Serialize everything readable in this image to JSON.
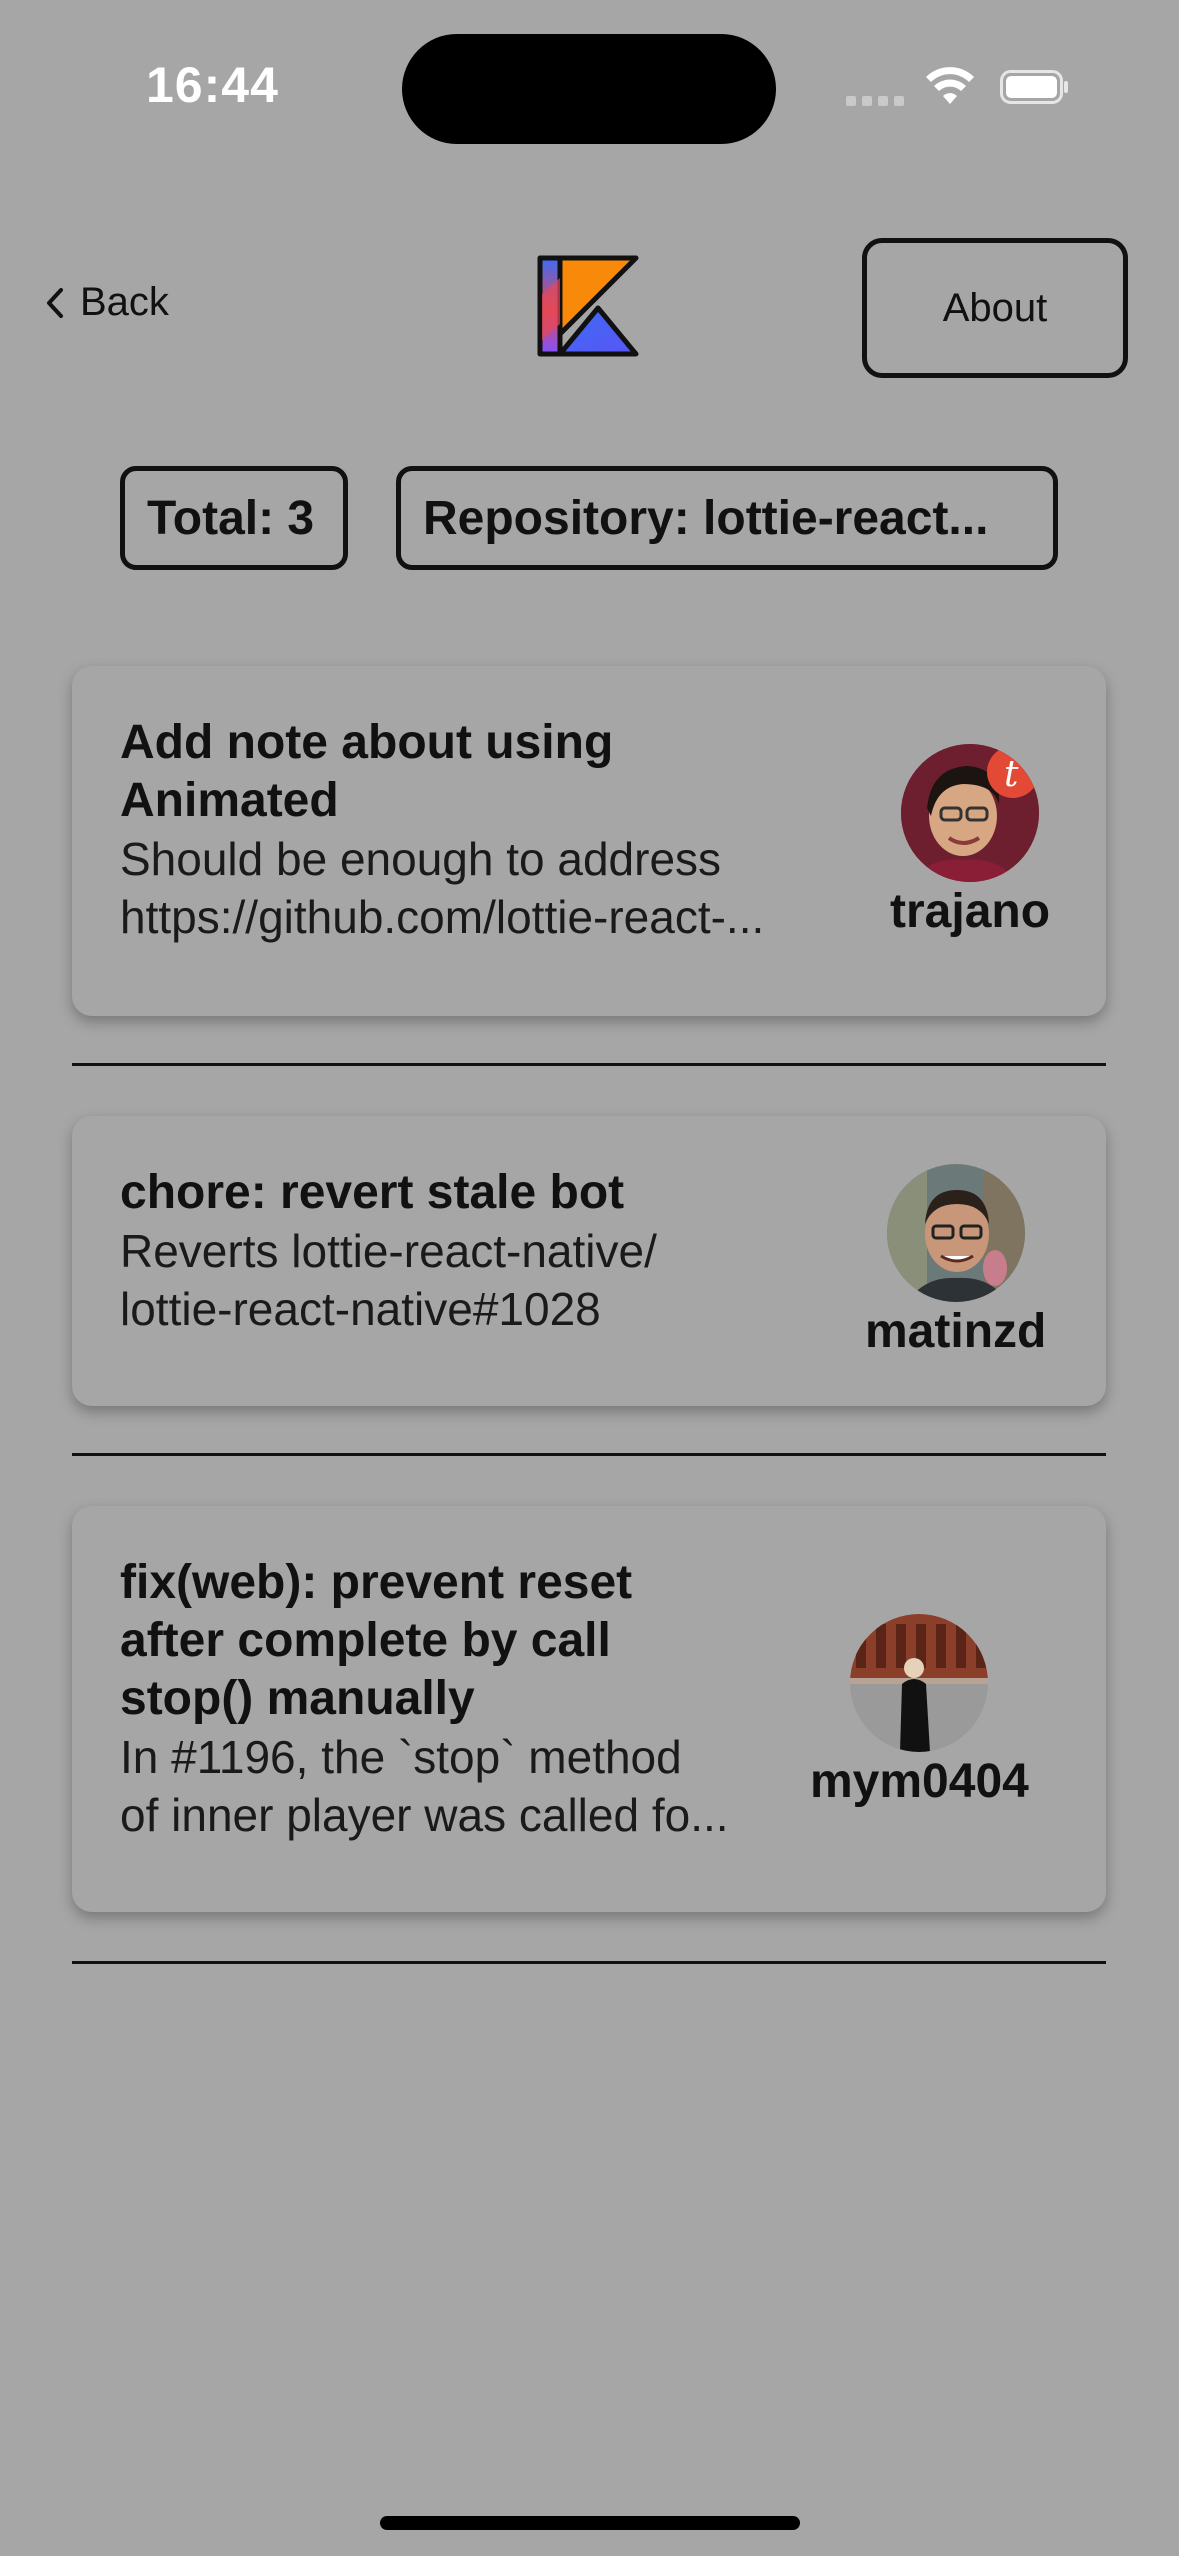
{
  "status_bar": {
    "time": "16:44"
  },
  "nav": {
    "back_label": "Back",
    "about_label": "About"
  },
  "summary": {
    "total_label": "Total: 3",
    "repository_label": "Repository: lottie-react..."
  },
  "pull_requests": [
    {
      "title": "Add note about using Animated",
      "body_line1": "Should be enough to address",
      "body_line2": "https://github.com/lottie-react-...",
      "author": "trajano"
    },
    {
      "title": "chore: revert stale bot",
      "body_line1": "Reverts lottie-react-native/",
      "body_line2": "lottie-react-native#1028",
      "author": "matinzd"
    },
    {
      "title": "fix(web): prevent reset after complete by call stop() manually",
      "body_line1": "In #1196, the `stop` method",
      "body_line2": "of inner player was called fo...",
      "author": "mym0404"
    }
  ],
  "icons": {
    "back": "chevron-left-icon",
    "logo": "kotlin-logo-icon",
    "wifi": "wifi-icon",
    "battery": "battery-icon"
  },
  "colors": {
    "background": "#a6a6a6",
    "text": "#111111",
    "logo_orange": "#f88909",
    "logo_pink": "#e44857",
    "logo_blue": "#3d6bf5",
    "logo_purple": "#7f52ff"
  }
}
